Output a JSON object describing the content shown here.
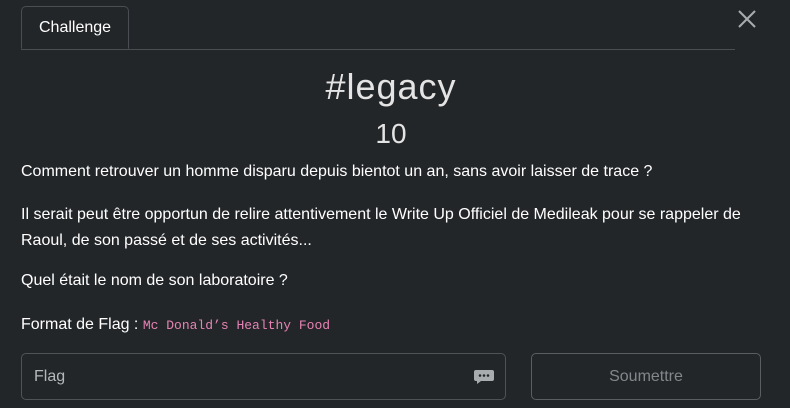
{
  "tabs": [
    {
      "label": "Challenge",
      "active": true
    }
  ],
  "challenge": {
    "name": "#legacy",
    "points": "10",
    "description_lines": [
      "Comment retrouver un homme disparu depuis bientot un an, sans avoir laisser de trace ?",
      "Il serait peut être opportun de relire attentivement le Write Up Officiel de Medileak pour se rappeler de Raoul, de son passé et de ses activités...",
      "Quel était le nom de son laboratoire ?"
    ],
    "format_label": "Format de Flag :",
    "format_example": "Mc Donald’s Healthy Food"
  },
  "form": {
    "flag_placeholder": "Flag",
    "flag_value": "",
    "submit_label": "Soumettre"
  },
  "icons": {
    "close": "close-icon",
    "input_helper": "chat-bubble-icon"
  },
  "colors": {
    "background": "#232629",
    "border": "#4a4e53",
    "code": "#e683b4",
    "muted_button_text": "#83878b"
  }
}
